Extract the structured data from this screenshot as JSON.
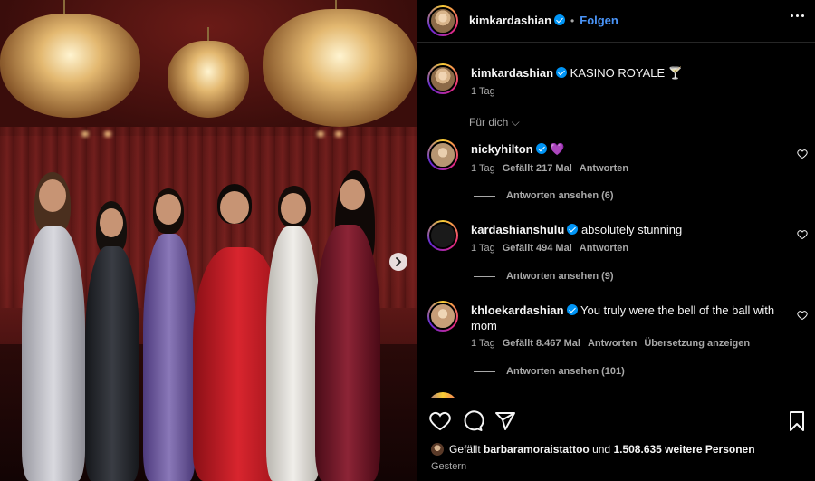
{
  "header": {
    "username": "kimkardashian",
    "dot": "•",
    "follow_label": "Folgen"
  },
  "caption": {
    "username": "kimkardashian",
    "text": "KASINO ROYALE 🍸",
    "time": "1 Tag"
  },
  "for_you_label": "Für dich ⌵",
  "comments": [
    {
      "username": "nickyhilton",
      "text": "💜",
      "time": "1 Tag",
      "likes": "Gefällt 217 Mal",
      "reply_label": "Antworten",
      "view_replies": "Antworten ansehen (6)"
    },
    {
      "username": "kardashianshulu",
      "text": "absolutely stunning",
      "time": "1 Tag",
      "likes": "Gefällt 494 Mal",
      "reply_label": "Antworten",
      "view_replies": "Antworten ansehen (9)"
    },
    {
      "username": "khloekardashian",
      "text": "You truly were the bell of the ball with mom",
      "time": "1 Tag",
      "likes": "Gefällt 8.467 Mal",
      "reply_label": "Antworten",
      "translate_label": "Übersetzung anzeigen",
      "view_replies": "Antworten ansehen (101)"
    }
  ],
  "likes_bar": {
    "prefix": "Gefällt",
    "user": "barbaramoraistattoo",
    "middle": "und",
    "count_text": "1.508.635 weitere Personen"
  },
  "posted": "Gestern",
  "colors": {
    "background": "#000000",
    "link_blue": "#4a94f7",
    "verified_blue": "#0095f6",
    "muted": "#a8a8a8"
  }
}
